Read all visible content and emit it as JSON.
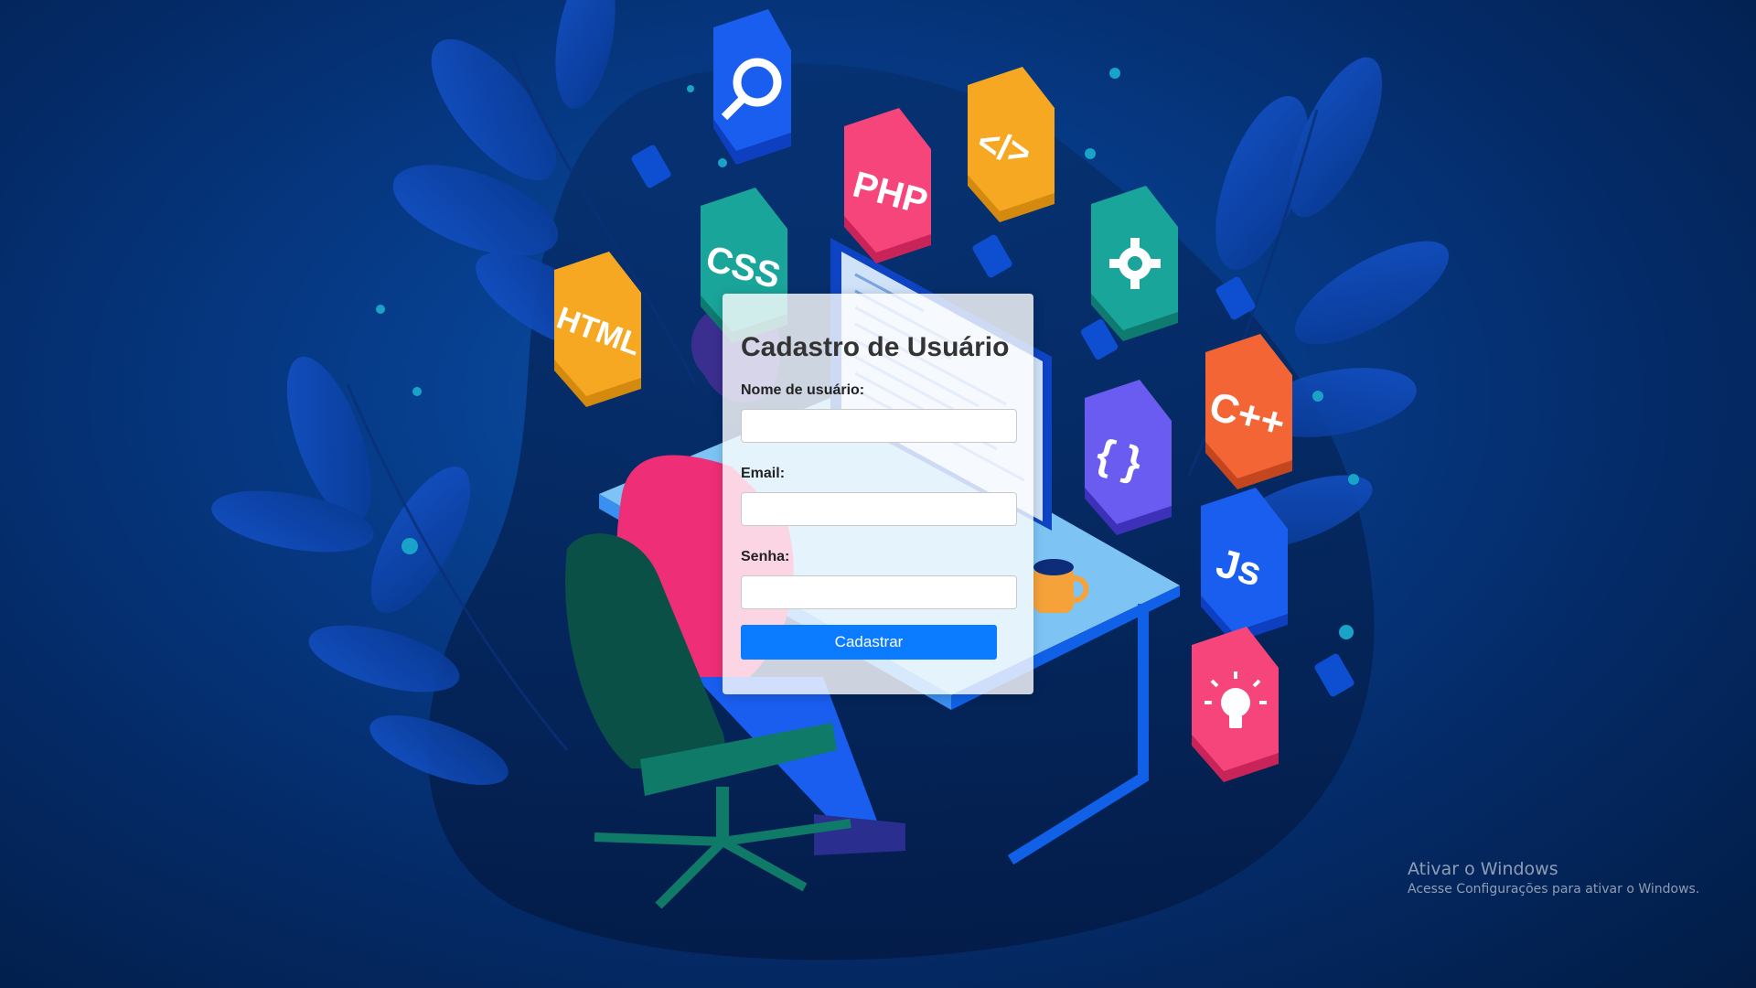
{
  "form": {
    "title": "Cadastro de Usuário",
    "username_label": "Nome de usuário:",
    "username_value": "",
    "email_label": "Email:",
    "email_value": "",
    "password_label": "Senha:",
    "password_value": "",
    "submit_label": "Cadastrar"
  },
  "illustration": {
    "badges": [
      {
        "icon": "search-icon",
        "color": "#1a5ef0"
      },
      {
        "label": "PHP",
        "color": "#f5457a"
      },
      {
        "label": "</>",
        "color": "#f7a822"
      },
      {
        "label": "CSS",
        "color": "#1aa59a"
      },
      {
        "icon": "gear-icon",
        "color": "#1aa59a"
      },
      {
        "label": "HTML",
        "color": "#f7a822"
      },
      {
        "label": "C++",
        "color": "#f46536"
      },
      {
        "label": "{ }",
        "color": "#6a5cf0"
      },
      {
        "label": "Js",
        "color": "#1a5ef0"
      },
      {
        "icon": "lightbulb-icon",
        "color": "#f5457a"
      }
    ]
  },
  "watermark": {
    "title": "Ativar o Windows",
    "subtitle": "Acesse Configurações para ativar o Windows."
  },
  "colors": {
    "background": "#063a86",
    "button": "#0b7bff",
    "title_text": "#333333"
  }
}
